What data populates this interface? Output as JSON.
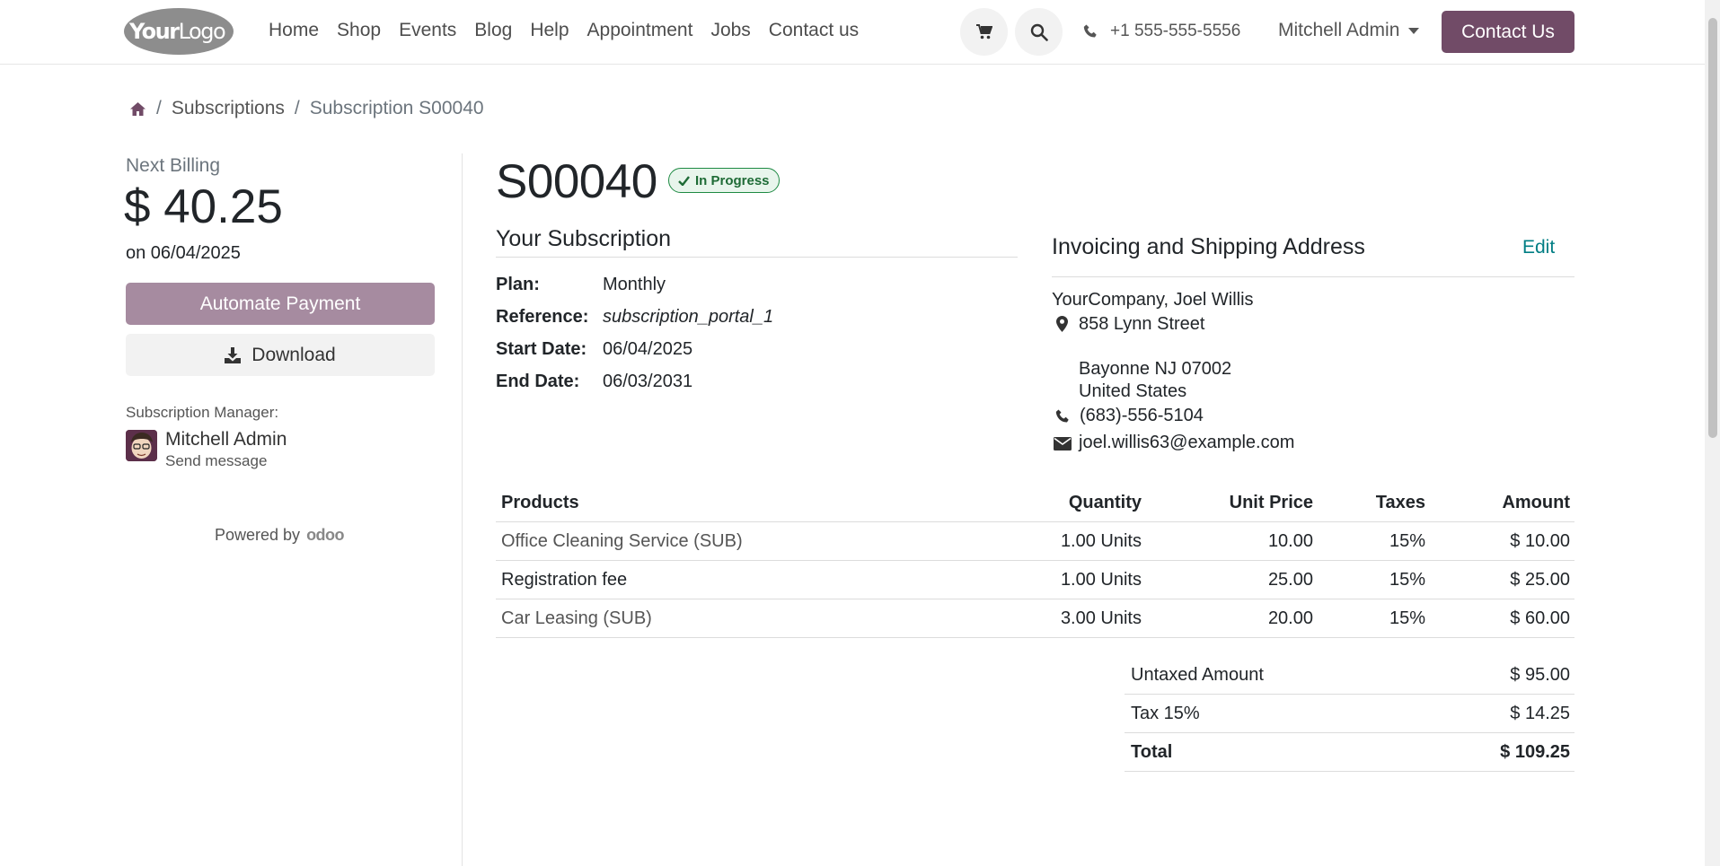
{
  "header": {
    "logo_text_bold": "Your",
    "logo_text_light": "Logo",
    "nav": [
      "Home",
      "Shop",
      "Events",
      "Blog",
      "Help",
      "Appointment",
      "Jobs",
      "Contact us"
    ],
    "phone": "+1 555-555-5556",
    "user": "Mitchell Admin",
    "contact_button": "Contact Us"
  },
  "breadcrumb": {
    "home_icon": "home-icon",
    "items": [
      "Subscriptions",
      "Subscription S00040"
    ]
  },
  "sidebar": {
    "next_billing_label": "Next Billing",
    "next_billing_amount": "$ 40.25",
    "next_billing_date": "on 06/04/2025",
    "automate_button": "Automate Payment",
    "download_button": "Download",
    "manager_label": "Subscription Manager:",
    "manager_name": "Mitchell Admin",
    "send_message": "Send message",
    "powered_by": "Powered by",
    "powered_brand": "odoo"
  },
  "subscription": {
    "number": "S00040",
    "status": "In Progress",
    "section_title": "Your Subscription",
    "fields": [
      {
        "label": "Plan:",
        "value": "Monthly"
      },
      {
        "label": "Reference:",
        "value": "subscription_portal_1"
      },
      {
        "label": "Start Date:",
        "value": "06/04/2025"
      },
      {
        "label": "End Date:",
        "value": "06/03/2031"
      }
    ]
  },
  "address": {
    "title": "Invoicing and Shipping Address",
    "edit": "Edit",
    "name": "YourCompany, Joel Willis",
    "street": "858 Lynn Street",
    "city_line": "Bayonne NJ 07002",
    "country": "United States",
    "phone": "(683)-556-5104",
    "email": "joel.willis63@example.com"
  },
  "products": {
    "headers": [
      "Products",
      "Quantity",
      "Unit Price",
      "Taxes",
      "Amount"
    ],
    "rows": [
      {
        "name": "Office Cleaning Service (SUB)",
        "qty": "1.00 Units",
        "price": "10.00",
        "tax": "15%",
        "amount": "$ 10.00"
      },
      {
        "name": "Registration fee",
        "qty": "1.00 Units",
        "price": "25.00",
        "tax": "15%",
        "amount": "$ 25.00"
      },
      {
        "name": "Car Leasing (SUB)",
        "qty": "3.00 Units",
        "price": "20.00",
        "tax": "15%",
        "amount": "$ 60.00"
      }
    ]
  },
  "totals": {
    "untaxed_label": "Untaxed Amount",
    "untaxed_value": "$ 95.00",
    "tax_label": "Tax 15%",
    "tax_value": "$ 14.25",
    "total_label": "Total",
    "total_value": "$ 109.25"
  },
  "colors": {
    "brand": "#714b67",
    "brand_light": "#a68ba0",
    "status_green": "#1e8a43",
    "link_teal": "#017e84"
  }
}
